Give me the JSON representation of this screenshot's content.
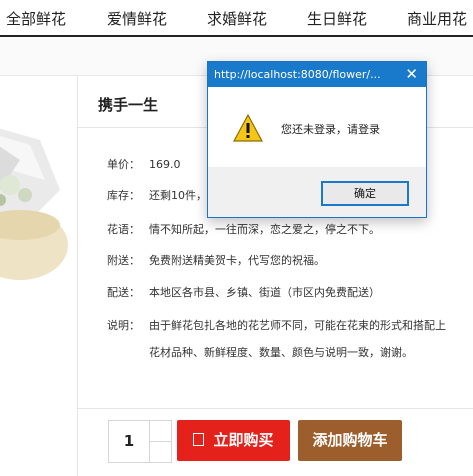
{
  "nav": {
    "items": [
      "全部鲜花",
      "爱情鲜花",
      "求婚鲜花",
      "生日鲜花",
      "商业用花"
    ]
  },
  "product": {
    "title": "携手一生",
    "price_label": "单价：",
    "price": "169.0",
    "stock_label": "库存：",
    "stock": "还剩10件，",
    "language_label": "花语：",
    "language": "情不知所起，一往而深，恋之爱之，停之不下。",
    "gift_label": "附送：",
    "gift": "免费附送精美贺卡，代写您的祝福。",
    "delivery_label": "配送：",
    "delivery": "本地区各市县、乡镇、街道（市区内免费配送）",
    "note_label": "说明：",
    "note_line1": "由于鲜花包扎各地的花艺师不同，可能在花束的形式和搭配上",
    "note_line2": "花材品种、新鲜程度、数量、颜色与说明一致，谢谢。"
  },
  "purchase": {
    "quantity": "1",
    "buy_label": "立即购买",
    "cart_label": "添加购物车"
  },
  "dialog": {
    "title": "http://localhost:8080/flower/...",
    "close": "✕",
    "message": "您还未登录，请登录",
    "ok_label": "确定",
    "icon": "warning-icon"
  },
  "colors": {
    "buy": "#e4221b",
    "cart": "#9b5e2c",
    "dialog_titlebar": "#1979ca"
  }
}
